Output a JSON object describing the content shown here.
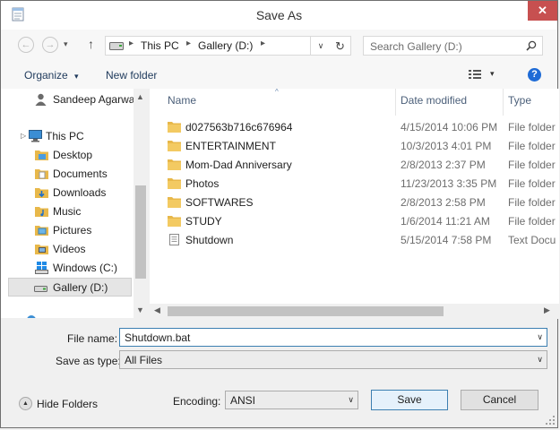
{
  "window": {
    "title": "Save As",
    "close_glyph": "✕"
  },
  "navbar": {
    "back_glyph": "←",
    "forward_glyph": "→",
    "up_glyph": "↑",
    "address_segments": [
      "This PC",
      "Gallery (D:)"
    ],
    "separator_glyph": "▸",
    "dropdown_glyph": "∨",
    "refresh_glyph": "↻",
    "search_placeholder": "Search Gallery (D:)"
  },
  "toolbar": {
    "organize_label": "Organize",
    "new_folder_label": "New folder",
    "caret_glyph": "▾",
    "help_glyph": "?"
  },
  "nav_pane": {
    "items": [
      {
        "label": "Sandeep Agarwa",
        "icon": "user-icon"
      },
      {
        "label": "This PC",
        "icon": "computer-icon"
      },
      {
        "label": "Desktop",
        "icon": "folder-icon"
      },
      {
        "label": "Documents",
        "icon": "folder-icon"
      },
      {
        "label": "Downloads",
        "icon": "folder-icon"
      },
      {
        "label": "Music",
        "icon": "folder-icon"
      },
      {
        "label": "Pictures",
        "icon": "folder-icon"
      },
      {
        "label": "Videos",
        "icon": "folder-icon"
      },
      {
        "label": "Windows (C:)",
        "icon": "windows-drive-icon"
      },
      {
        "label": "Gallery (D:)",
        "icon": "drive-icon",
        "selected": true
      }
    ],
    "expand_glyph": "▷"
  },
  "file_list": {
    "columns": [
      "Name",
      "Date modified",
      "Type"
    ],
    "sort_glyph": "^",
    "rows": [
      {
        "name": "d027563b716c676964",
        "date": "4/15/2014 10:06 PM",
        "type": "File folder",
        "icon": "folder-icon"
      },
      {
        "name": "ENTERTAINMENT",
        "date": "10/3/2013 4:01 PM",
        "type": "File folder",
        "icon": "folder-icon"
      },
      {
        "name": "Mom-Dad Anniversary",
        "date": "2/8/2013 2:37 PM",
        "type": "File folder",
        "icon": "folder-icon"
      },
      {
        "name": "Photos",
        "date": "11/23/2013 3:35 PM",
        "type": "File folder",
        "icon": "folder-icon"
      },
      {
        "name": "SOFTWARES",
        "date": "2/8/2013 2:58 PM",
        "type": "File folder",
        "icon": "folder-icon"
      },
      {
        "name": "STUDY",
        "date": "1/6/2014 11:21 AM",
        "type": "File folder",
        "icon": "folder-icon"
      },
      {
        "name": "Shutdown",
        "date": "5/15/2014 7:58 PM",
        "type": "Text Docu",
        "icon": "text-file-icon"
      }
    ]
  },
  "scroll": {
    "up": "▲",
    "down": "▼",
    "left": "◀",
    "right": "▶"
  },
  "form": {
    "file_name_label": "File name:",
    "file_name_value": "Shutdown.bat",
    "save_type_label": "Save as type:",
    "save_type_value": "All Files",
    "encoding_label": "Encoding:",
    "encoding_value": "ANSI",
    "caret_glyph": "∨"
  },
  "buttons": {
    "hide_folders": "Hide Folders",
    "hide_glyph": "▲",
    "save": "Save",
    "cancel": "Cancel"
  },
  "colors": {
    "accent": "#3c7fb1",
    "folder": "#e8b84a",
    "selection": "#e5e5e5"
  }
}
